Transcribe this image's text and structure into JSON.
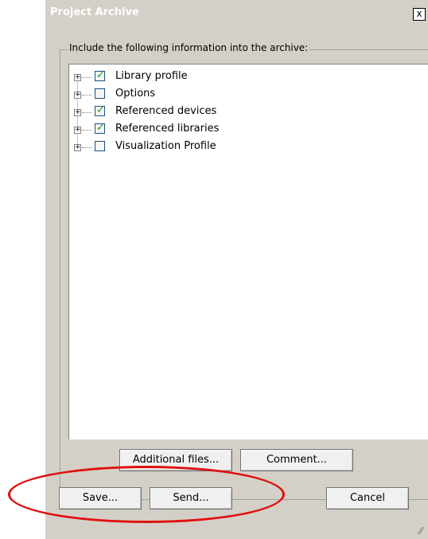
{
  "window": {
    "title": "Project Archive",
    "close_label": "x"
  },
  "group": {
    "label": "Include the following information into the archive:"
  },
  "tree": {
    "items": [
      {
        "label": "Library profile",
        "checked": true
      },
      {
        "label": "Options",
        "checked": false
      },
      {
        "label": "Referenced devices",
        "checked": true
      },
      {
        "label": "Referenced libraries",
        "checked": true
      },
      {
        "label": "Visualization Profile",
        "checked": false
      }
    ],
    "expander_symbol": "+",
    "check_symbol": "✓"
  },
  "buttons": {
    "additional_files": "Additional files...",
    "comment": "Comment...",
    "save": "Save...",
    "send": "Send...",
    "cancel": "Cancel"
  },
  "colors": {
    "annotation": "#e01010",
    "dialog_bg": "#d4d0c8",
    "check": "#21a121"
  }
}
